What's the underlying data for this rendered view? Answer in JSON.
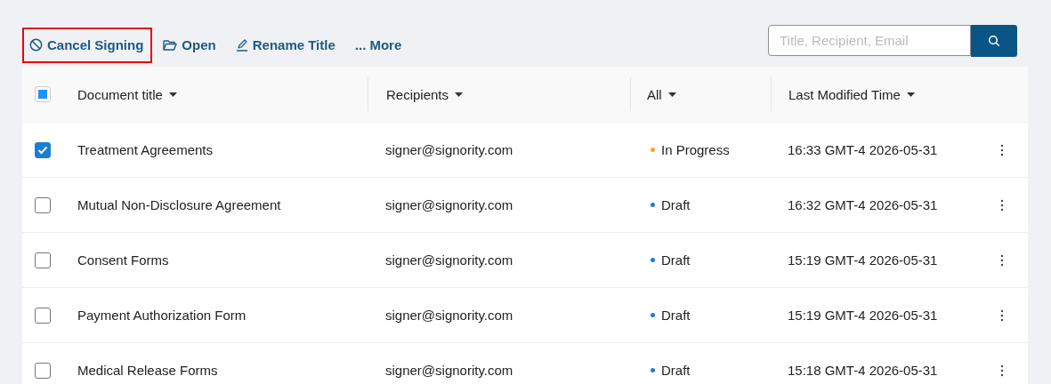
{
  "toolbar": {
    "actions": [
      {
        "kind": "cancel",
        "label": "Cancel Signing",
        "highlighted": true
      },
      {
        "kind": "open",
        "label": "Open",
        "highlighted": false
      },
      {
        "kind": "rename",
        "label": "Rename Title",
        "highlighted": false
      },
      {
        "kind": "more",
        "label": "... More",
        "highlighted": false
      }
    ]
  },
  "search": {
    "placeholder": "Title, Recipient, Email"
  },
  "table": {
    "select_all": {
      "checked": false,
      "indeterminate": true
    },
    "columns": [
      {
        "label": "Document title"
      },
      {
        "label": "Recipients"
      },
      {
        "label": "All"
      },
      {
        "label": "Last Modified Time"
      }
    ],
    "rows": [
      {
        "checked": true,
        "title": "Treatment Agreements",
        "recipient": "signer@signority.com",
        "status": "In Progress",
        "color": "#f5a623",
        "time": "16:33 GMT-4 2026-05-31"
      },
      {
        "checked": false,
        "title": "Mutual Non-Disclosure Agreement",
        "recipient": "signer@signority.com",
        "status": "Draft",
        "color": "#1a7fd0",
        "time": "16:32 GMT-4 2026-05-31"
      },
      {
        "checked": false,
        "title": "Consent Forms",
        "recipient": "signer@signority.com",
        "status": "Draft",
        "color": "#1a7fd0",
        "time": "15:19 GMT-4 2026-05-31"
      },
      {
        "checked": false,
        "title": "Payment Authorization Form",
        "recipient": "signer@signority.com",
        "status": "Draft",
        "color": "#1a7fd0",
        "time": "15:19 GMT-4 2026-05-31"
      },
      {
        "checked": false,
        "title": "Medical Release Forms",
        "recipient": "signer@signority.com",
        "status": "Draft",
        "color": "#1a7fd0",
        "time": "15:18 GMT-4 2026-05-31"
      }
    ]
  }
}
